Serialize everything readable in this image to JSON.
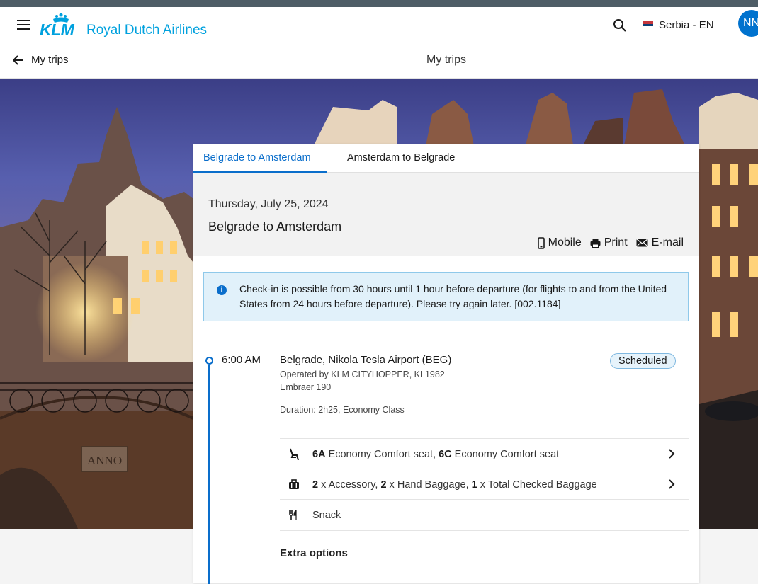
{
  "header": {
    "brand": "KLM",
    "brand_subtitle": "Royal Dutch Airlines",
    "country": "Serbia - EN",
    "avatar_initials": "NN"
  },
  "subnav": {
    "back_label": "My trips",
    "title": "My trips"
  },
  "tabs": [
    {
      "label": "Belgrade to Amsterdam",
      "active": true
    },
    {
      "label": "Amsterdam to Belgrade",
      "active": false
    }
  ],
  "summary": {
    "date": "Thursday, July 25, 2024",
    "route": "Belgrade to Amsterdam",
    "actions": {
      "mobile": "Mobile",
      "print": "Print",
      "email": "E-mail"
    }
  },
  "notice": {
    "text": "Check-in is possible from 30 hours until 1 hour before departure (for flights to and from the United States from 24 hours before departure). Please try again later. [002.1184]"
  },
  "flight": {
    "time": "6:00 AM",
    "airport": "Belgrade, Nikola Tesla Airport (BEG)",
    "status": "Scheduled",
    "operated_by": "Operated by KLM CITYHOPPER, KL1982",
    "aircraft": "Embraer 190",
    "duration": "Duration: 2h25, Economy Class",
    "seats": {
      "seat1": "6A",
      "seat1_label": " Economy Comfort seat, ",
      "seat2": "6C",
      "seat2_label": " Economy Comfort seat"
    },
    "baggage": {
      "q1": "2",
      "t1": " x Accessory, ",
      "q2": "2",
      "t2": " x Hand Baggage, ",
      "q3": "1",
      "t3": " x Total Checked Baggage"
    },
    "meal": "Snack",
    "extra_options": "Extra options"
  },
  "colors": {
    "accent": "#0a6ecb",
    "brand": "#00a1de",
    "notice_bg": "#e1f1fa"
  },
  "icons": [
    "menu-icon",
    "crown-icon",
    "search-icon",
    "serbia-flag-icon",
    "arrow-left-icon",
    "mobile-icon",
    "print-icon",
    "email-icon",
    "info-icon",
    "seat-icon",
    "baggage-icon",
    "cutlery-icon",
    "chevron-right-icon"
  ]
}
